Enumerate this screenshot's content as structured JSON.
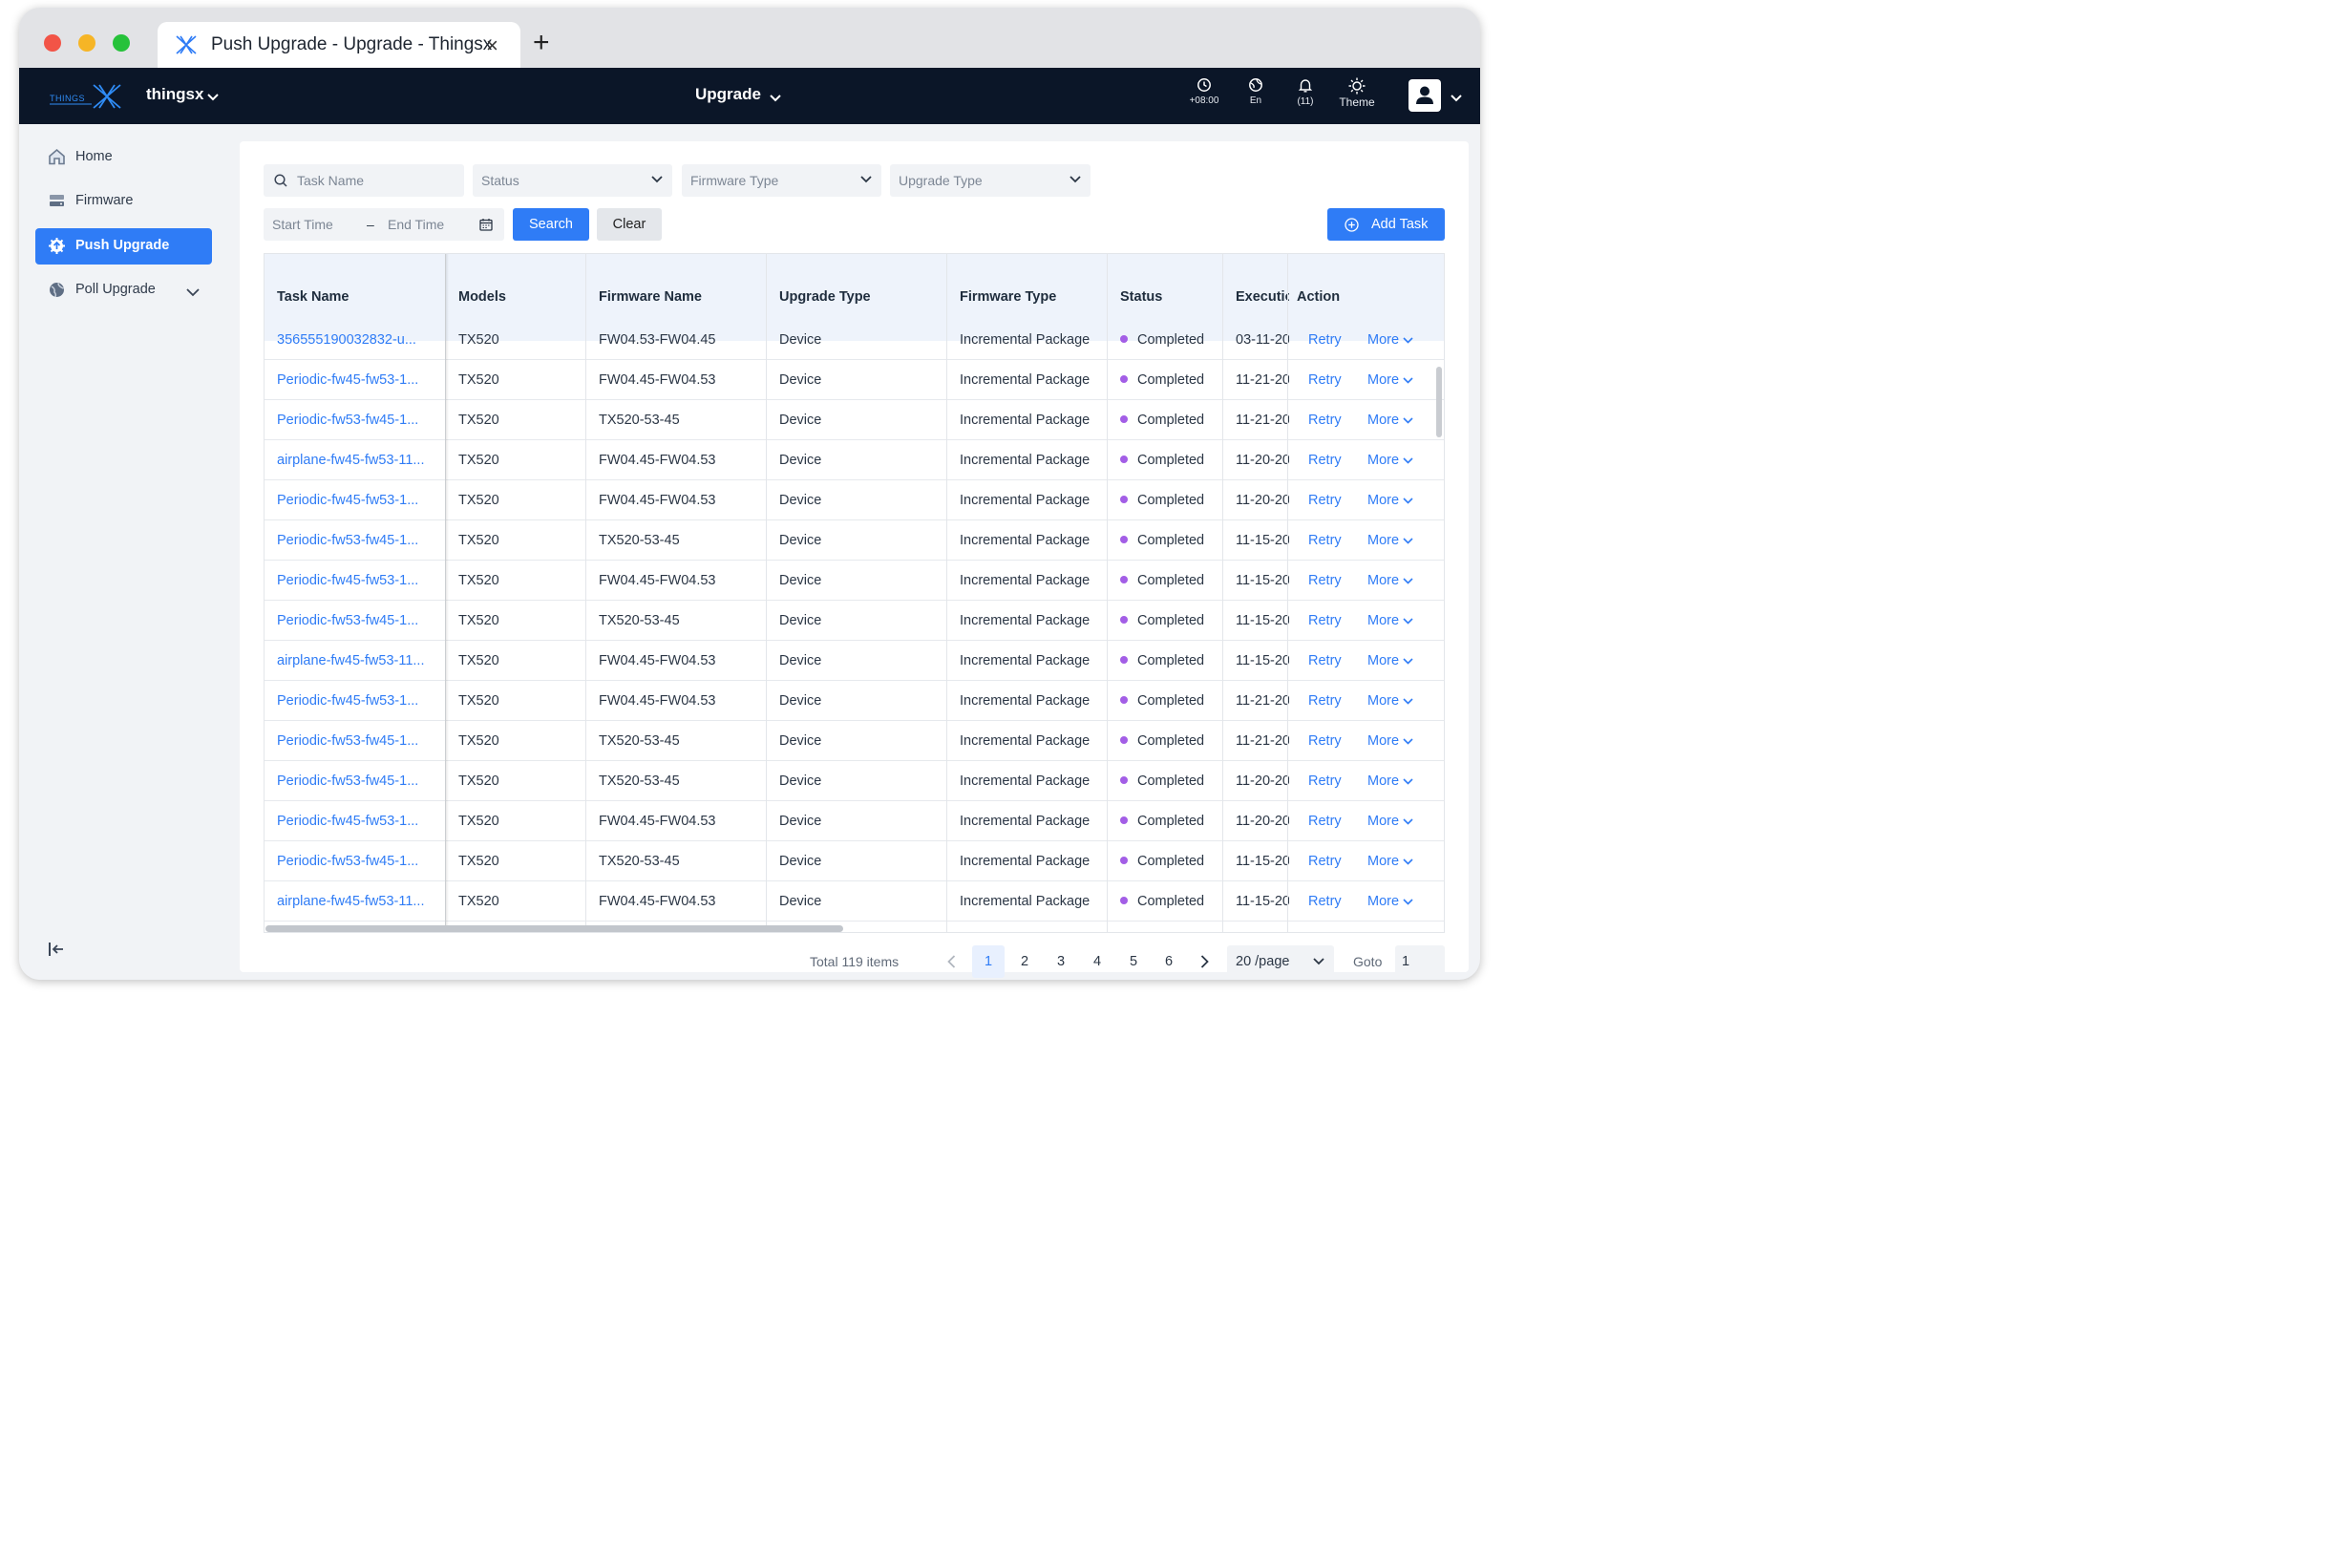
{
  "browser": {
    "tab_title": "Push Upgrade -  Upgrade - Thingsx",
    "close_glyph": "×",
    "new_tab_glyph": "+"
  },
  "topnav": {
    "logo_text": "THINGS",
    "org": "thingsx",
    "module": "Upgrade",
    "timezone": "+08:00",
    "language": "En",
    "notifications": "(11)",
    "theme": "Theme"
  },
  "sidebar": {
    "items": [
      {
        "label": "Home",
        "icon": "home-icon"
      },
      {
        "label": "Firmware",
        "icon": "firmware-icon"
      },
      {
        "label": "Push Upgrade",
        "icon": "push-upgrade-icon",
        "active": true
      },
      {
        "label": "Poll Upgrade",
        "icon": "globe-icon",
        "expandable": true
      }
    ]
  },
  "filters": {
    "task_name_placeholder": "Task Name",
    "status_placeholder": "Status",
    "firmware_type_placeholder": "Firmware Type",
    "upgrade_type_placeholder": "Upgrade Type",
    "start_time_placeholder": "Start Time",
    "range_separator": "–",
    "end_time_placeholder": "End Time",
    "search_label": "Search",
    "clear_label": "Clear",
    "add_task_label": "Add Task"
  },
  "table": {
    "columns": [
      "Task Name",
      "Models",
      "Firmware Name",
      "Upgrade Type",
      "Firmware Type",
      "Status",
      "Executio",
      "Action"
    ],
    "retry_label": "Retry",
    "more_label": "More",
    "rows": [
      {
        "task": "356555190032832-u...",
        "model": "TX520",
        "firmware": "FW04.53-FW04.45",
        "upgrade": "Device",
        "ftype": "Incremental Package",
        "status": "Completed",
        "exec": "03-11-20"
      },
      {
        "task": "Periodic-fw45-fw53-1...",
        "model": "TX520",
        "firmware": "FW04.45-FW04.53",
        "upgrade": "Device",
        "ftype": "Incremental Package",
        "status": "Completed",
        "exec": "11-21-20"
      },
      {
        "task": "Periodic-fw53-fw45-1...",
        "model": "TX520",
        "firmware": "TX520-53-45",
        "upgrade": "Device",
        "ftype": "Incremental Package",
        "status": "Completed",
        "exec": "11-21-20"
      },
      {
        "task": "airplane-fw45-fw53-11...",
        "model": "TX520",
        "firmware": "FW04.45-FW04.53",
        "upgrade": "Device",
        "ftype": "Incremental Package",
        "status": "Completed",
        "exec": "11-20-20"
      },
      {
        "task": "Periodic-fw45-fw53-1...",
        "model": "TX520",
        "firmware": "FW04.45-FW04.53",
        "upgrade": "Device",
        "ftype": "Incremental Package",
        "status": "Completed",
        "exec": "11-20-20"
      },
      {
        "task": "Periodic-fw53-fw45-1...",
        "model": "TX520",
        "firmware": "TX520-53-45",
        "upgrade": "Device",
        "ftype": "Incremental Package",
        "status": "Completed",
        "exec": "11-15-20"
      },
      {
        "task": "Periodic-fw45-fw53-1...",
        "model": "TX520",
        "firmware": "FW04.45-FW04.53",
        "upgrade": "Device",
        "ftype": "Incremental Package",
        "status": "Completed",
        "exec": "11-15-20"
      },
      {
        "task": "Periodic-fw53-fw45-1...",
        "model": "TX520",
        "firmware": "TX520-53-45",
        "upgrade": "Device",
        "ftype": "Incremental Package",
        "status": "Completed",
        "exec": "11-15-20"
      },
      {
        "task": "airplane-fw45-fw53-11...",
        "model": "TX520",
        "firmware": "FW04.45-FW04.53",
        "upgrade": "Device",
        "ftype": "Incremental Package",
        "status": "Completed",
        "exec": "11-15-20"
      },
      {
        "task": "Periodic-fw45-fw53-1...",
        "model": "TX520",
        "firmware": "FW04.45-FW04.53",
        "upgrade": "Device",
        "ftype": "Incremental Package",
        "status": "Completed",
        "exec": "11-21-20"
      },
      {
        "task": "Periodic-fw53-fw45-1...",
        "model": "TX520",
        "firmware": "TX520-53-45",
        "upgrade": "Device",
        "ftype": "Incremental Package",
        "status": "Completed",
        "exec": "11-21-20"
      },
      {
        "task": "Periodic-fw53-fw45-1...",
        "model": "TX520",
        "firmware": "TX520-53-45",
        "upgrade": "Device",
        "ftype": "Incremental Package",
        "status": "Completed",
        "exec": "11-20-20"
      },
      {
        "task": "Periodic-fw45-fw53-1...",
        "model": "TX520",
        "firmware": "FW04.45-FW04.53",
        "upgrade": "Device",
        "ftype": "Incremental Package",
        "status": "Completed",
        "exec": "11-20-20"
      },
      {
        "task": "Periodic-fw53-fw45-1...",
        "model": "TX520",
        "firmware": "TX520-53-45",
        "upgrade": "Device",
        "ftype": "Incremental Package",
        "status": "Completed",
        "exec": "11-15-20"
      },
      {
        "task": "airplane-fw45-fw53-11...",
        "model": "TX520",
        "firmware": "FW04.45-FW04.53",
        "upgrade": "Device",
        "ftype": "Incremental Package",
        "status": "Completed",
        "exec": "11-15-20"
      }
    ]
  },
  "pagination": {
    "total": "Total 119 items",
    "pages": [
      "1",
      "2",
      "3",
      "4",
      "5",
      "6"
    ],
    "current": "1",
    "page_size": "20 /page",
    "goto_label": "Goto",
    "goto_value": "1"
  },
  "colors": {
    "accent": "#2f7cf6",
    "nav_bg": "#0b1628",
    "status_completed": "#a35ee6"
  }
}
